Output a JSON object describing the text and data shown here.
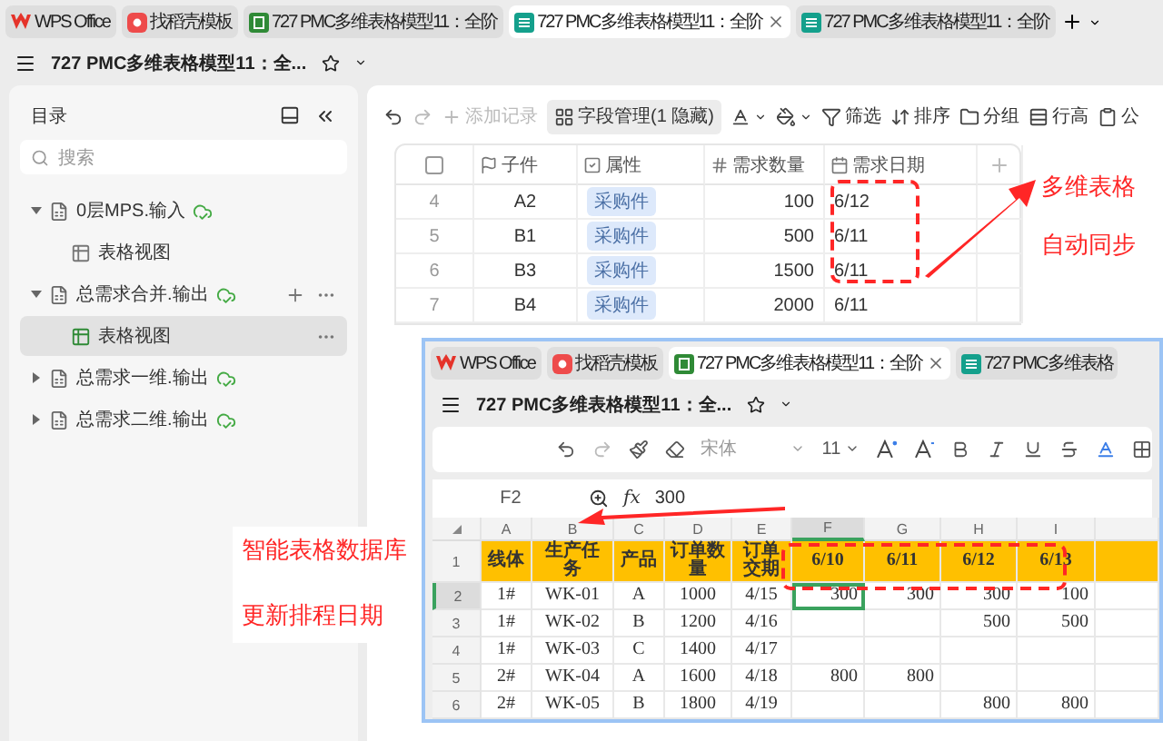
{
  "app_tabs": [
    {
      "label": "WPS Office",
      "kind": "wps",
      "selected": false
    },
    {
      "label": "找稻壳模板",
      "kind": "template",
      "selected": false
    },
    {
      "label": "727 PMC多维表格模型11：全阶",
      "kind": "sheet",
      "selected": false
    },
    {
      "label": "727 PMC多维表格模型11：全阶",
      "kind": "smart",
      "selected": true
    },
    {
      "label": "727 PMC多维表格模型11：全阶",
      "kind": "smart",
      "selected": false
    }
  ],
  "doc_title": "727 PMC多维表格模型11：全...",
  "sidebar": {
    "title": "目录",
    "search": {
      "placeholder": "搜索"
    },
    "items": [
      {
        "label": "0层MPS.输入",
        "expanded": true,
        "children": [
          {
            "label": "表格视图",
            "selected": false
          }
        ]
      },
      {
        "label": "总需求合并.输出",
        "expanded": true,
        "children": [
          {
            "label": "表格视图",
            "selected": true
          }
        ]
      },
      {
        "label": "总需求一维.输出",
        "expanded": false
      },
      {
        "label": "总需求二维.输出",
        "expanded": false
      }
    ]
  },
  "toolbar": [
    {
      "kind": "undo"
    },
    {
      "kind": "redo"
    },
    {
      "kind": "add",
      "label": "添加记录",
      "disabled": true
    },
    {
      "kind": "fields",
      "label": "字段管理(1 隐藏)"
    },
    {
      "kind": "text-color"
    },
    {
      "kind": "fill"
    },
    {
      "kind": "filter",
      "label": "筛选"
    },
    {
      "kind": "sort",
      "label": "排序"
    },
    {
      "kind": "group",
      "label": "分组"
    },
    {
      "kind": "row-height",
      "label": "行高"
    },
    {
      "kind": "share",
      "label": "公"
    }
  ],
  "table": {
    "select_all": {
      "checked": false
    },
    "columns": [
      {
        "label": "子件",
        "kind": "text"
      },
      {
        "label": "属性",
        "kind": "select"
      },
      {
        "label": "需求数量",
        "kind": "number"
      },
      {
        "label": "需求日期",
        "kind": "date"
      }
    ],
    "rows": [
      {
        "number": "4",
        "cells": [
          "A2",
          "采购件",
          "100",
          "6/12"
        ]
      },
      {
        "number": "5",
        "cells": [
          "B1",
          "采购件",
          "500",
          "6/11"
        ]
      },
      {
        "number": "6",
        "cells": [
          "B3",
          "采购件",
          "1500",
          "6/11"
        ]
      },
      {
        "number": "7",
        "cells": [
          "B4",
          "采购件",
          "2000",
          "6/11"
        ]
      }
    ]
  },
  "callout_top": {
    "lines": [
      "多维表格",
      "自动同步"
    ]
  },
  "callout_left": {
    "lines": [
      "智能表格数据库",
      "更新排程日期"
    ]
  },
  "overlay_window": {
    "tabs": [
      {
        "label": "WPS Office",
        "kind": "wps",
        "selected": false
      },
      {
        "label": "找稻壳模板",
        "kind": "template",
        "selected": false
      },
      {
        "label": "727 PMC多维表格模型11：全阶",
        "kind": "sheet",
        "selected": true
      },
      {
        "label": "727 PMC多维表格",
        "kind": "smart",
        "selected": false
      }
    ],
    "doc_title": "727 PMC多维表格模型11：全...",
    "toolbar": {
      "font": "宋体",
      "size": "11"
    },
    "formula_bar": {
      "cell": "F2",
      "function_symbol": "fx",
      "value": "300"
    },
    "sheet": {
      "columns": [
        {
          "label": "A",
          "kind": "text",
          "selected": false
        },
        {
          "label": "B",
          "kind": "text",
          "selected": false
        },
        {
          "label": "C",
          "kind": "text",
          "selected": false
        },
        {
          "label": "D",
          "kind": "text",
          "selected": false
        },
        {
          "label": "E",
          "kind": "text",
          "selected": false
        },
        {
          "label": "F",
          "kind": "value",
          "selected": true
        },
        {
          "label": "G",
          "kind": "value",
          "selected": false
        },
        {
          "label": "H",
          "kind": "value",
          "selected": false
        },
        {
          "label": "I",
          "kind": "value",
          "selected": false
        }
      ],
      "rows": [
        {
          "number": "1",
          "kind": "header",
          "selected": false,
          "cells": [
            "线体",
            "生产任务",
            "产品",
            "订单数量",
            "订单交期",
            "6/10",
            "6/11",
            "6/12",
            "6/13"
          ]
        },
        {
          "number": "2",
          "kind": "data",
          "selected": true,
          "cells": [
            "1#",
            "WK-01",
            "A",
            "1000",
            "4/15",
            "300",
            "300",
            "300",
            "100"
          ]
        },
        {
          "number": "3",
          "kind": "data",
          "selected": false,
          "cells": [
            "1#",
            "WK-02",
            "B",
            "1200",
            "4/16",
            "",
            "",
            "500",
            "500"
          ]
        },
        {
          "number": "4",
          "kind": "data",
          "selected": false,
          "cells": [
            "1#",
            "WK-03",
            "C",
            "1400",
            "4/17",
            "",
            "",
            "",
            ""
          ]
        },
        {
          "number": "5",
          "kind": "data",
          "selected": false,
          "cells": [
            "2#",
            "WK-04",
            "A",
            "1600",
            "4/18",
            "800",
            "800",
            "",
            ""
          ]
        },
        {
          "number": "6",
          "kind": "data",
          "selected": false,
          "cells": [
            "2#",
            "WK-05",
            "B",
            "1800",
            "4/19",
            "",
            "",
            "800",
            "800"
          ]
        }
      ]
    }
  }
}
